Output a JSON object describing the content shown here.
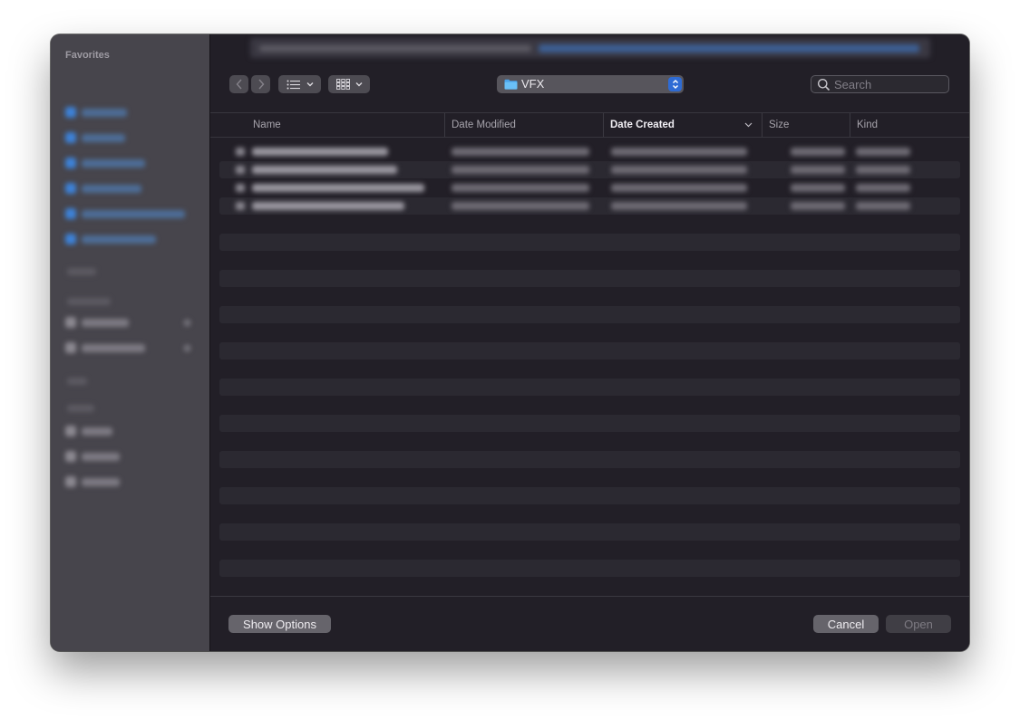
{
  "sidebar": {
    "favorites_title": "Favorites"
  },
  "toolbar": {
    "back_label": "‹",
    "forward_label": "›",
    "list_view_label": "☰",
    "gallery_view_label": "▦",
    "folder_name": "VFX",
    "search_placeholder": "Search"
  },
  "table": {
    "columns": [
      {
        "label": "Name"
      },
      {
        "label": "Date Modified"
      },
      {
        "label": "Date Created",
        "sorted": true
      },
      {
        "label": "Size"
      },
      {
        "label": "Kind"
      }
    ]
  },
  "footer": {
    "show_options_label": "Show Options",
    "cancel_label": "Cancel",
    "open_label": "Open"
  },
  "colors": {
    "accent": "#2e6bd4",
    "window_bg": "#221f27",
    "sidebar_bg": "#47454c",
    "folder_blue": "#4aa3ea"
  }
}
